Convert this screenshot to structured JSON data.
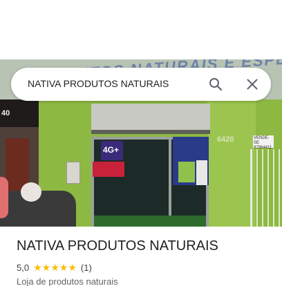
{
  "search": {
    "query": "NATIVA PRODUTOS NATURAIS",
    "search_icon": "search-icon",
    "close_icon": "close-icon"
  },
  "photo": {
    "store_sign_text": "PRODUTOS NATURAIS E ESPECIARIAS",
    "left_building_number": "40",
    "door_poster_text": "4G+",
    "house_number": "6420",
    "right_sign_text": "VENDE-SE 97964411"
  },
  "place": {
    "name": "NATIVA PRODUTOS NATURAIS",
    "rating": "5,0",
    "stars": 5,
    "reviews": "(1)",
    "category": "Loja de produtos naturais"
  },
  "colors": {
    "star": "#fbbc04",
    "text_primary": "#202124",
    "text_secondary": "#5f6368"
  }
}
